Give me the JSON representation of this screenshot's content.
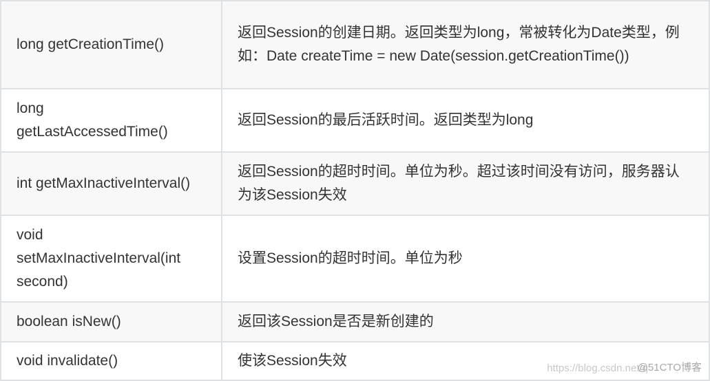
{
  "table": {
    "rows": [
      {
        "method": "long getCreationTime()",
        "description": "返回Session的创建日期。返回类型为long，常被转化为Date类型，例如：Date createTime = new Date(session.getCreationTime())"
      },
      {
        "method": "long getLastAccessedTime()",
        "description": "返回Session的最后活跃时间。返回类型为long"
      },
      {
        "method": "int getMaxInactiveInterval()",
        "description": "返回Session的超时时间。单位为秒。超过该时间没有访问，服务器认为该Session失效"
      },
      {
        "method": "void setMaxInactiveInterval(int second)",
        "description": "设置Session的超时时间。单位为秒"
      },
      {
        "method": "boolean isNew()",
        "description": "返回该Session是否是新创建的"
      },
      {
        "method": "void invalidate()",
        "description": "使该Session失效"
      }
    ]
  },
  "watermark_url": "https://blog.csdn.net/q",
  "watermark_site": "@51CTO博客"
}
